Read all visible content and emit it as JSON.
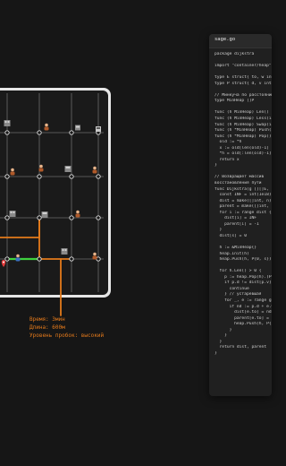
{
  "colors": {
    "background": "#161616",
    "tablet_frame": "#e6e6e6",
    "screen": "#1a1a1a",
    "grid_line": "#6b6b6b",
    "node": "#e0e0e0",
    "route_green": "#3fd13f",
    "route_orange": "#e47a1b",
    "code_panel": "#202020",
    "annotation": "#e47a1b"
  },
  "map": {
    "icons": [
      "building-icon",
      "person-icon",
      "destination-pin-icon"
    ]
  },
  "annotation": {
    "time": "Время: 3мин",
    "distance": "Длина: 600м",
    "difficulty": "Уровень пробок: высокий"
  },
  "code": {
    "filename": "sage.go",
    "lines": [
      "package dijkstra",
      "",
      "import \"container/heap\"",
      "",
      "type E struct{ to, w int }",
      "type P struct{ d, v int }",
      "",
      "// Минкуча по расстоянию",
      "type MinHeap []P",
      "",
      "func (h MinHeap) Len() int",
      "func (h MinHeap) Less(i, j",
      "func (h MinHeap) Swap(i, j",
      "func (h *MinHeap) Push(x",
      "func (h *MinHeap) Pop() any",
      "  old := *h",
      "  x := old[len(old)-1]",
      "  *h = old[:len(old)-1]",
      "  return x",
      "}",
      "",
      "// Возвращает массив",
      "восстановления пути",
      "func Dijkstra(g [][]E, s",
      "  const INF = int(1e18)",
      "  dist = make([]int, n)",
      "  parent = make([]int, n)",
      "  for i := range dist {",
      "    dist[i] = INF",
      "    parent[i] = -1",
      "  }",
      "  dist[s] = 0",
      "",
      "  h := &MinHeap{}",
      "  heap.Init(h)",
      "  heap.Push(h, P{0, s})",
      "",
      "  for h.Len() > 0 {",
      "    p := heap.Pop(h).(P)",
      "    if p.d != dist[p.v] {",
      "      continue",
      "    } // устаревшая",
      "    for _, e := range g[p.v]",
      "      if nd := p.d + e.w;",
      "        dist[e.to] = nd",
      "        parent[e.to] = p.v",
      "        heap.Push(h, P{nd",
      "      }",
      "    }",
      "  }",
      "  return dist, parent",
      "}"
    ]
  }
}
